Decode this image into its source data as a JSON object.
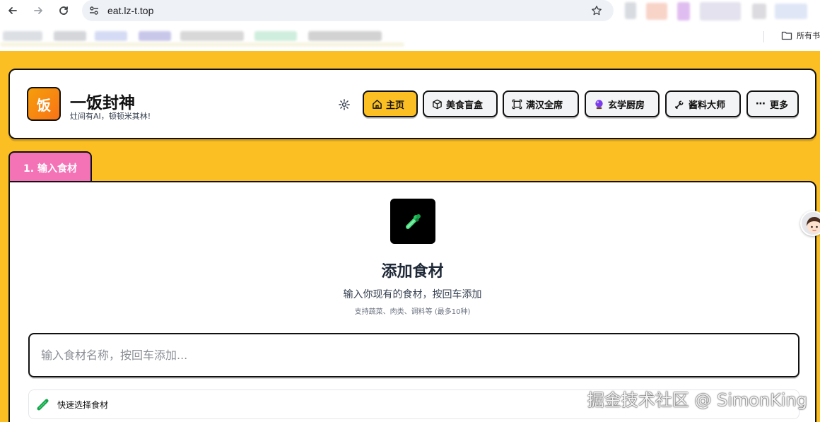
{
  "browser": {
    "url": "eat.lz-t.top",
    "bookmarks_all_label": "所有书"
  },
  "header": {
    "logo_char": "饭",
    "title": "一饭封神",
    "subtitle": "灶间有AI，顿顿米其林!",
    "nav": [
      {
        "label": "主页",
        "icon": "home-icon",
        "active": true
      },
      {
        "label": "美食盲盒",
        "icon": "cube-icon",
        "active": false
      },
      {
        "label": "满汉全席",
        "icon": "frame-icon",
        "active": false
      },
      {
        "label": "玄学厨房",
        "icon": "crystal-ball-icon",
        "active": false
      },
      {
        "label": "酱料大师",
        "icon": "wrench-icon",
        "active": false
      },
      {
        "label": "更多",
        "icon": "ellipsis-icon",
        "active": false
      }
    ]
  },
  "step_tab": "1. 输入食材",
  "main": {
    "title": "添加食材",
    "description": "输入你现有的食材，按回车添加",
    "hint": "支持蔬菜、肉类、调料等 (最多10种)",
    "input_placeholder": "输入食材名称，按回车添加...",
    "quick_select_label": "快速选择食材"
  },
  "watermark": "掘金技术社区 @ SimonKing",
  "colors": {
    "page_bg": "#fbbf24",
    "active_nav": "#fbbf24",
    "step_tab": "#f472b6",
    "logo": "#f97316"
  }
}
